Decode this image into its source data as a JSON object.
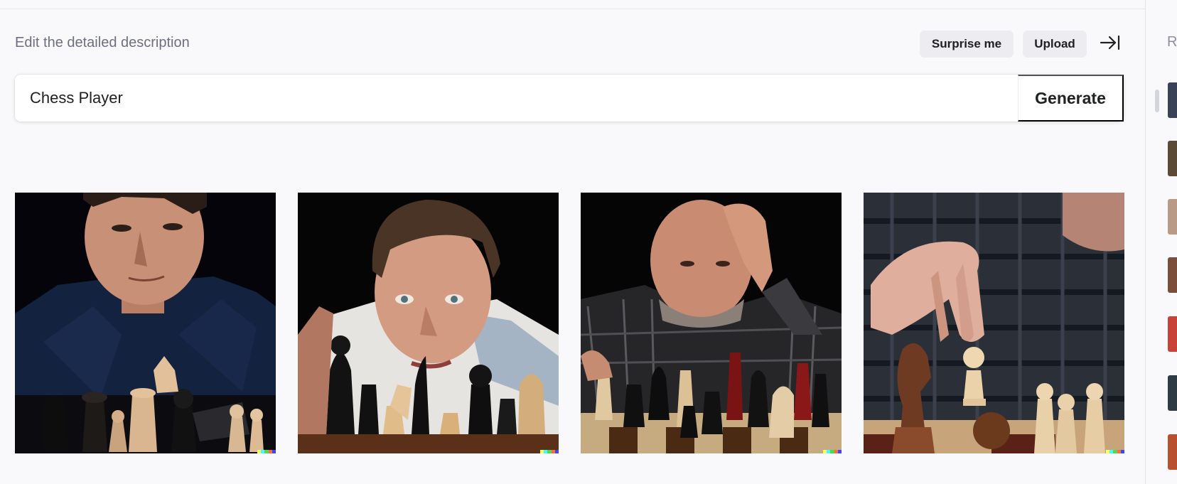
{
  "header": {
    "description_label": "Edit the detailed description",
    "surprise_label": "Surprise me",
    "upload_label": "Upload"
  },
  "prompt": {
    "value": "Chess Player",
    "generate_label": "Generate"
  },
  "results": [
    {
      "subject": "man in navy shirt behind chess pieces"
    },
    {
      "subject": "man in white shirt staring over chess pieces"
    },
    {
      "subject": "bald bearded man holding head over chess board"
    },
    {
      "subject": "hand moving white pawn on chess board"
    }
  ],
  "history_panel": {
    "title_initial": "R",
    "thumbnails": [
      "#3a4258",
      "#5a4a36",
      "#b89a86",
      "#7a4e3a",
      "#c8423a",
      "#2e3a44",
      "#b85030"
    ]
  },
  "colors": {
    "background": "#f9f9fb",
    "pill_button": "#ececf1",
    "signature": [
      "#ffff66",
      "#42ffff",
      "#51da4c",
      "#ff6e3c",
      "#3c46ff"
    ]
  }
}
